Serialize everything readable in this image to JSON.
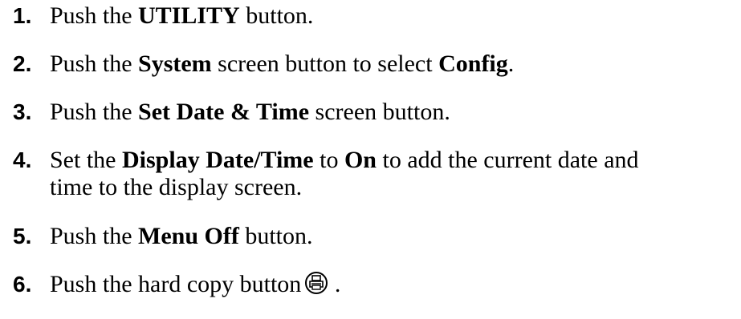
{
  "steps": [
    {
      "number": "1.",
      "parts": [
        "Push the ",
        "UTILITY",
        " button."
      ]
    },
    {
      "number": "2.",
      "parts": [
        "Push the ",
        "System",
        " screen button to select ",
        "Config",
        "."
      ]
    },
    {
      "number": "3.",
      "parts": [
        "Push the ",
        "Set Date & Time",
        " screen button."
      ]
    },
    {
      "number": "4.",
      "parts": [
        "Set the ",
        "Display Date/Time",
        " to ",
        "On",
        " to add the current date and"
      ],
      "line2": "time to the display screen."
    },
    {
      "number": "5.",
      "parts": [
        "Push the ",
        "Menu Off",
        " button."
      ]
    },
    {
      "number": "6.",
      "parts": [
        "Push the hard copy button",
        " ."
      ],
      "icon": "printer-icon"
    }
  ]
}
